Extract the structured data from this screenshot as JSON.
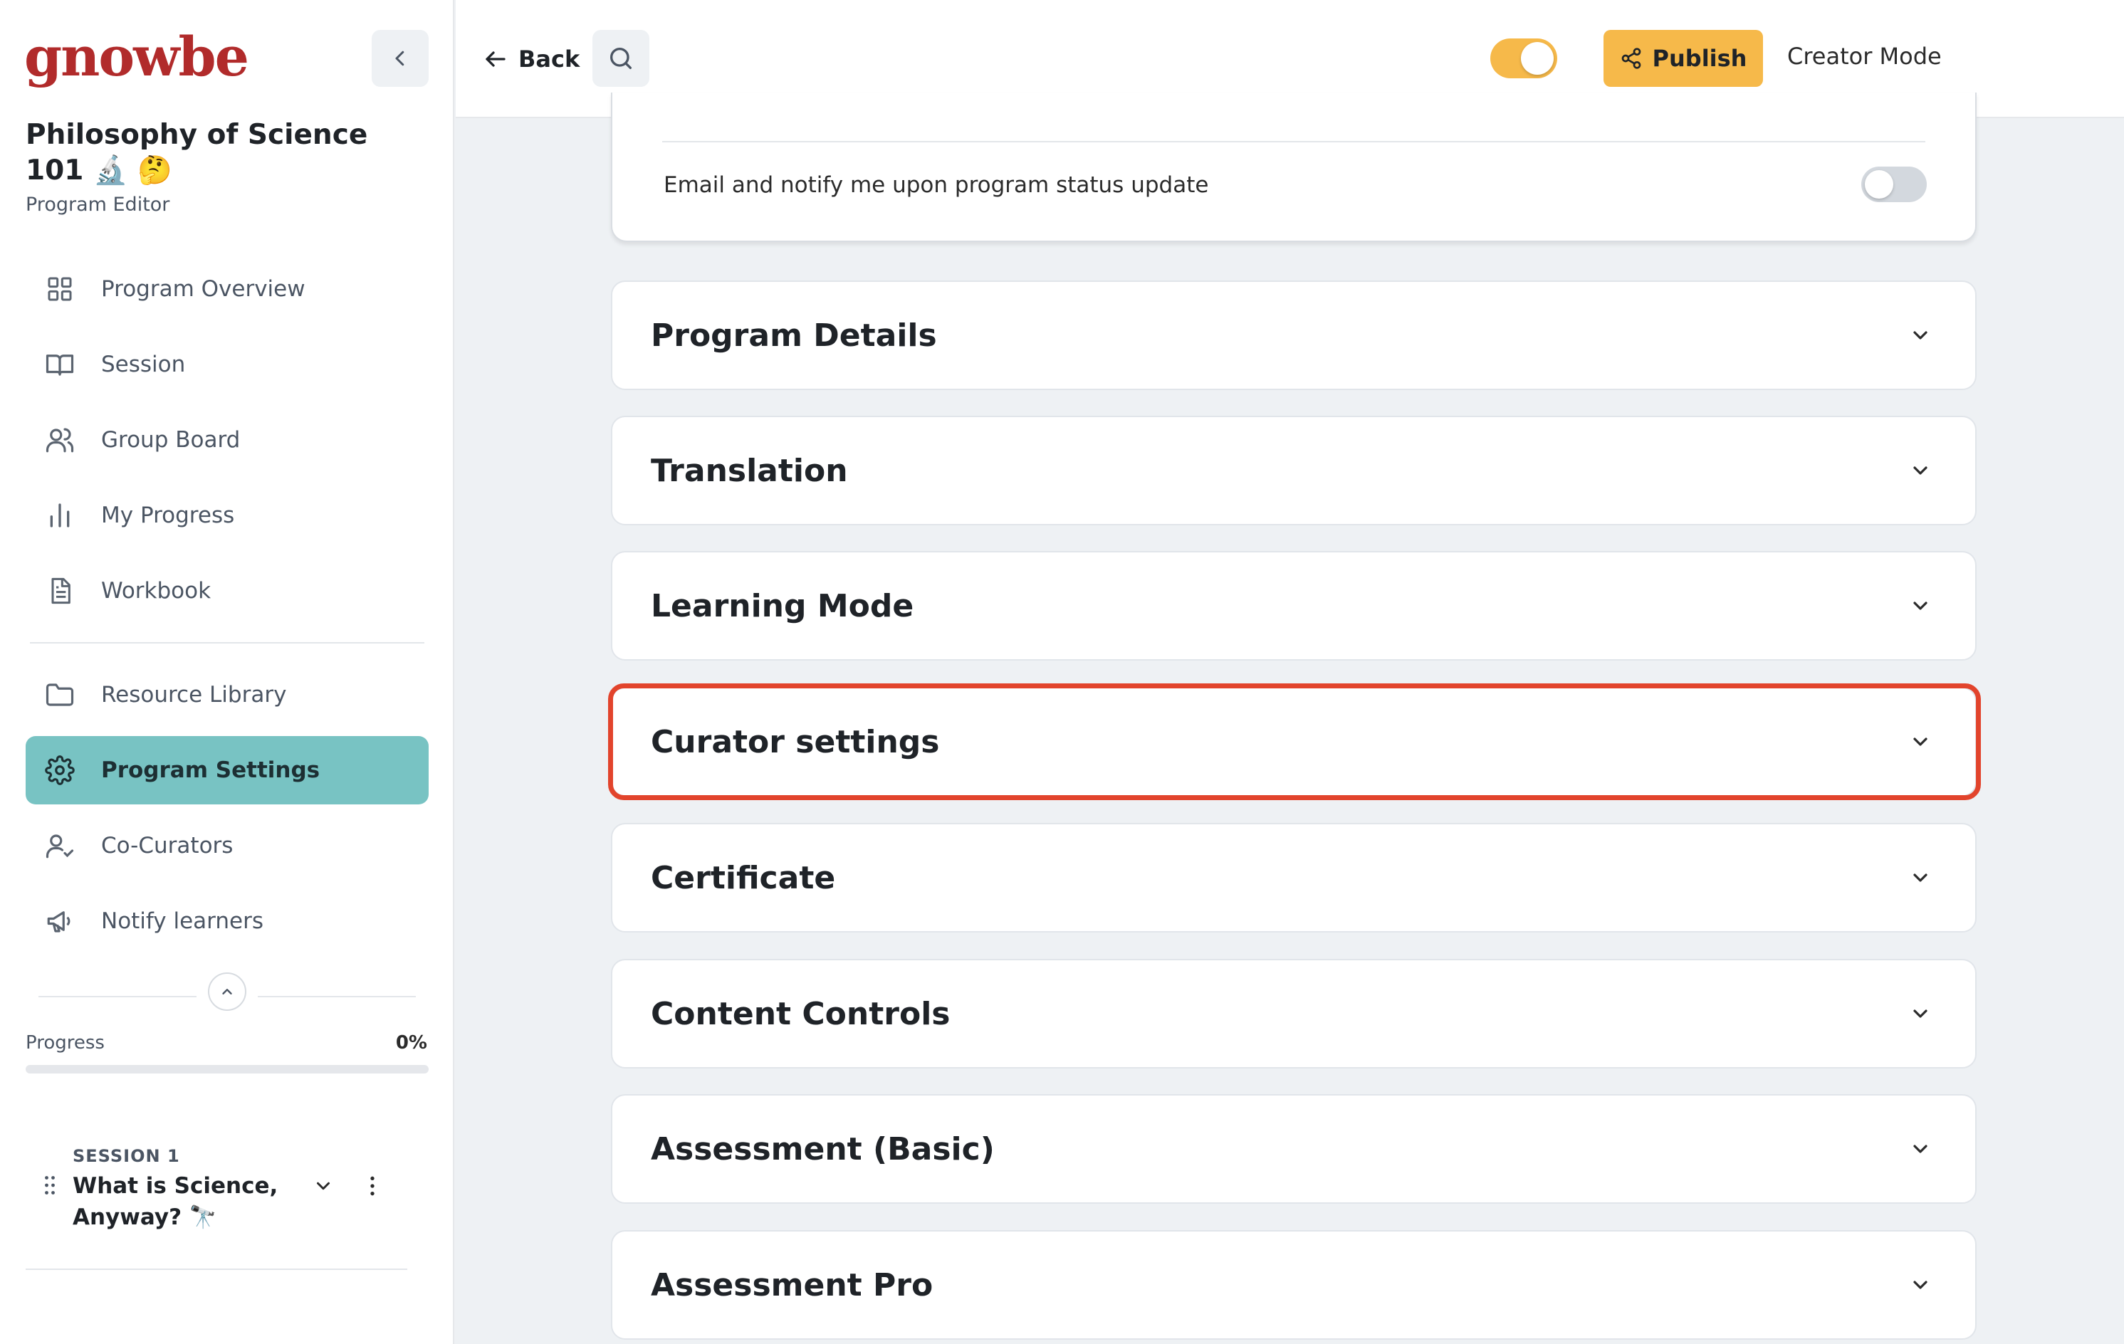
{
  "sidebar": {
    "logo": "gnowbe",
    "program_title": "Philosophy of Science 101 🔬 🤔",
    "program_subtitle": "Program Editor",
    "nav_primary": [
      {
        "label": "Program Overview",
        "icon": "grid-icon"
      },
      {
        "label": "Session",
        "icon": "book-open-icon"
      },
      {
        "label": "Group Board",
        "icon": "users-icon"
      },
      {
        "label": "My Progress",
        "icon": "bar-chart-icon"
      },
      {
        "label": "Workbook",
        "icon": "document-icon"
      }
    ],
    "nav_secondary": [
      {
        "label": "Resource Library",
        "icon": "folder-icon"
      },
      {
        "label": "Program Settings",
        "icon": "gear-icon",
        "active": true
      },
      {
        "label": "Co-Curators",
        "icon": "user-check-icon"
      },
      {
        "label": "Notify learners",
        "icon": "megaphone-icon"
      }
    ],
    "progress": {
      "label": "Progress",
      "value_text": "0%",
      "fraction": 0.0
    },
    "session": {
      "kicker": "SESSION 1",
      "title": "What is Science, Anyway? 🔭"
    }
  },
  "topbar": {
    "back_label": "Back",
    "publish_label": "Publish",
    "creator_mode_label": "Creator Mode",
    "creator_mode_on": true
  },
  "notify": {
    "text": "Email and notify me upon program status update",
    "enabled": false
  },
  "sections": [
    {
      "title": "Program Details"
    },
    {
      "title": "Translation"
    },
    {
      "title": "Learning Mode"
    },
    {
      "title": "Curator settings",
      "highlighted": true
    },
    {
      "title": "Certificate"
    },
    {
      "title": "Content Controls"
    },
    {
      "title": "Assessment (Basic)"
    },
    {
      "title": "Assessment Pro"
    }
  ],
  "colors": {
    "brand": "#b12b2b",
    "accent_active": "#78c3c3",
    "publish": "#f6b94a",
    "highlight": "#e2442c"
  }
}
